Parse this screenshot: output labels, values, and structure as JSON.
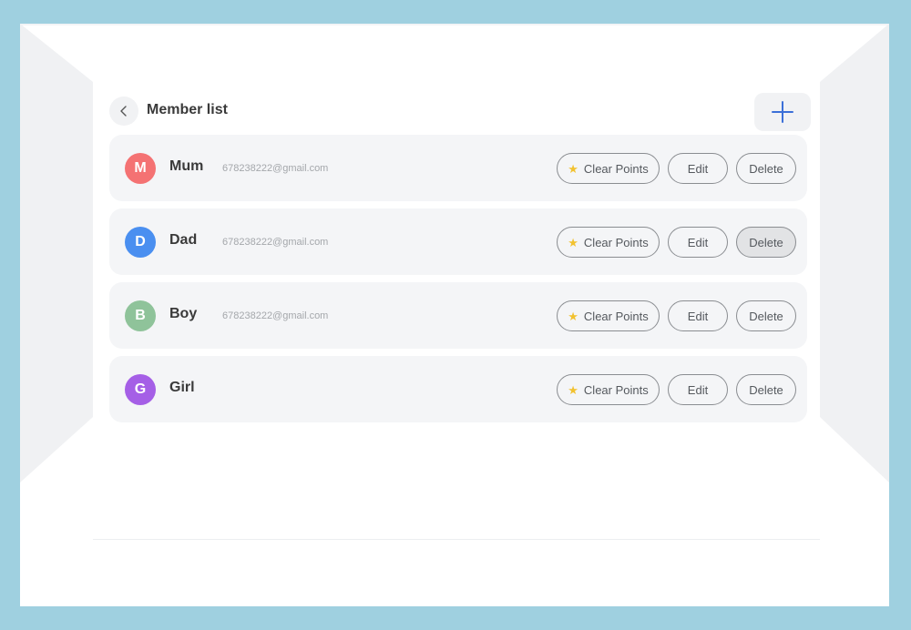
{
  "header": {
    "title": "Member list"
  },
  "actions": {
    "clear_points_label": "Clear Points",
    "edit_label": "Edit",
    "delete_label": "Delete"
  },
  "members": [
    {
      "initial": "M",
      "name": "Mum",
      "email": "678238222@gmail.com",
      "color": "#f47273"
    },
    {
      "initial": "D",
      "name": "Dad",
      "email": "678238222@gmail.com",
      "color": "#4a8ff0"
    },
    {
      "initial": "B",
      "name": "Boy",
      "email": "678238222@gmail.com",
      "color": "#8fc39a"
    },
    {
      "initial": "G",
      "name": "Girl",
      "email": "",
      "color": "#a55fe6"
    }
  ],
  "icons": {
    "back": "chevron-left-icon",
    "add": "plus-icon",
    "star": "star-icon"
  },
  "colors": {
    "accent": "#3b6fd8",
    "star": "#f2c230"
  }
}
